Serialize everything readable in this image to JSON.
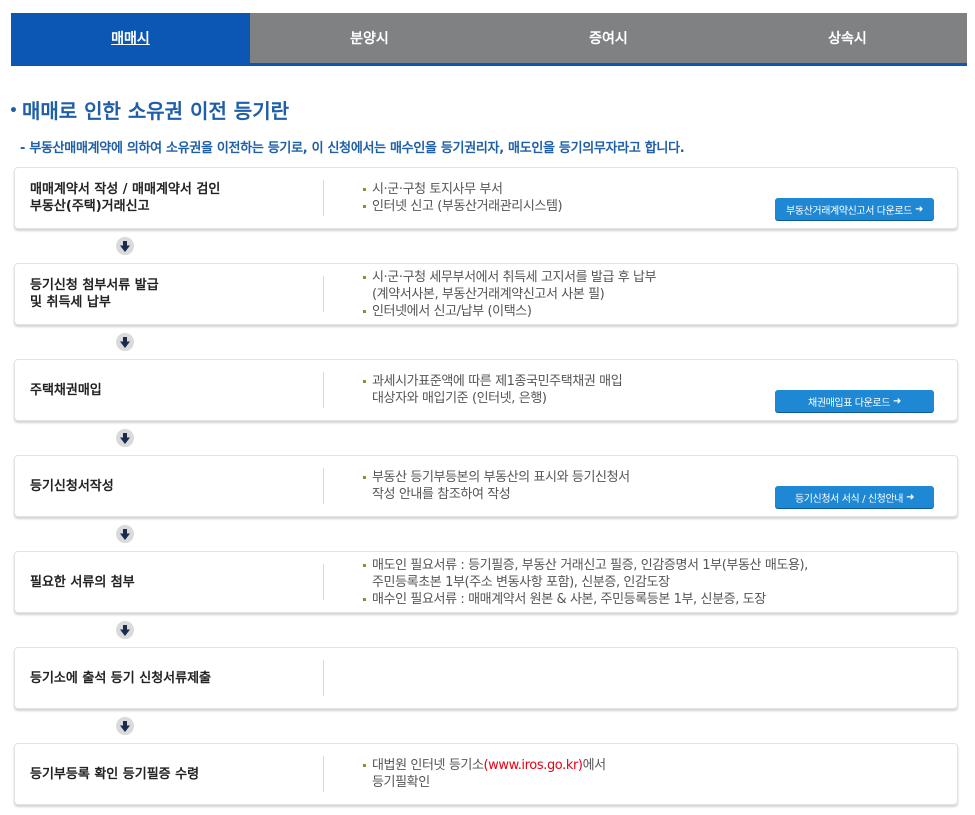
{
  "tabs": [
    {
      "label": "매매시"
    },
    {
      "label": "분양시"
    },
    {
      "label": "증여시"
    },
    {
      "label": "상속시"
    }
  ],
  "title": "매매로 인한 소유권 이전 등기란",
  "subtitle": "- 부동산매매계약에 의하여 소유권을 이전하는 등기로, 이 신청에서는 매수인을 등기권리자, 매도인을 등기의무자라고 합니다.",
  "steps": [
    {
      "title": [
        "매매계약서 작성 / 매매계약서 검인",
        "부동산(주택)거래신고"
      ],
      "desc": [
        {
          "text": "시·군·구청 토지사무 부서",
          "bullet": true
        },
        {
          "text": "인터넷 신고 (부동산거래관리시스템)",
          "bullet": true
        }
      ],
      "button": "부동산거래계약신고서 다운로드"
    },
    {
      "title": [
        "등기신청 첨부서류 발급",
        "및 취득세 납부"
      ],
      "desc": [
        {
          "text": "시·군·구청 세무부서에서 취득세 고지서를 발급 후 납부",
          "bullet": true
        },
        {
          "text": "(계약서사본, 부동산거래계약신고서 사본 필)",
          "bullet": false
        },
        {
          "text": "인터넷에서 신고/납부 (이택스)",
          "bullet": true
        }
      ]
    },
    {
      "title": [
        "주택채권매입"
      ],
      "desc": [
        {
          "text": "과세시가표준액에 따른 제1종국민주택채권 매입",
          "bullet": true
        },
        {
          "text": "대상자와 매입기준 (인터넷, 은행)",
          "bullet": false
        }
      ],
      "button": "채권매입표 다운로드"
    },
    {
      "title": [
        "등기신청서작성"
      ],
      "desc": [
        {
          "text": "부동산 등기부등본의 부동산의 표시와 등기신청서",
          "bullet": true
        },
        {
          "text": "작성 안내를 참조하여 작성",
          "bullet": false
        }
      ],
      "button": "등기신청서 서식 / 신청안내"
    },
    {
      "title": [
        "필요한 서류의 첨부"
      ],
      "desc": [
        {
          "text": "매도인 필요서류 : 등기필증, 부동산 거래신고 필증, 인감증명서 1부(부동산 매도용),",
          "bullet": true
        },
        {
          "text": "주민등록초본 1부(주소 변동사항 포함), 신분증, 인감도장",
          "bullet": false
        },
        {
          "text": "매수인 필요서류 : 매매계약서 원본 & 사본, 주민등록등본 1부, 신분증, 도장",
          "bullet": true
        }
      ]
    },
    {
      "title": [
        "등기소에 출석 등기 신청서류제출"
      ],
      "desc": []
    },
    {
      "title": [
        "등기부등록 확인 등기필증 수령"
      ],
      "desc_special": {
        "pre": "대법원 인터넷 등기소",
        "link": "(www.iros.go.kr)",
        "post": "에서",
        "line2": "등기필확인"
      }
    }
  ],
  "colors": {
    "tab_active": "#0d57b4",
    "tab_inactive": "#7f8183",
    "title": "#1f5fa7",
    "button": "#1f88d5",
    "link": "#e60012"
  },
  "icons": {
    "step_arrow": "arrow-down-icon",
    "button_arrow": "arrow-right-icon"
  }
}
